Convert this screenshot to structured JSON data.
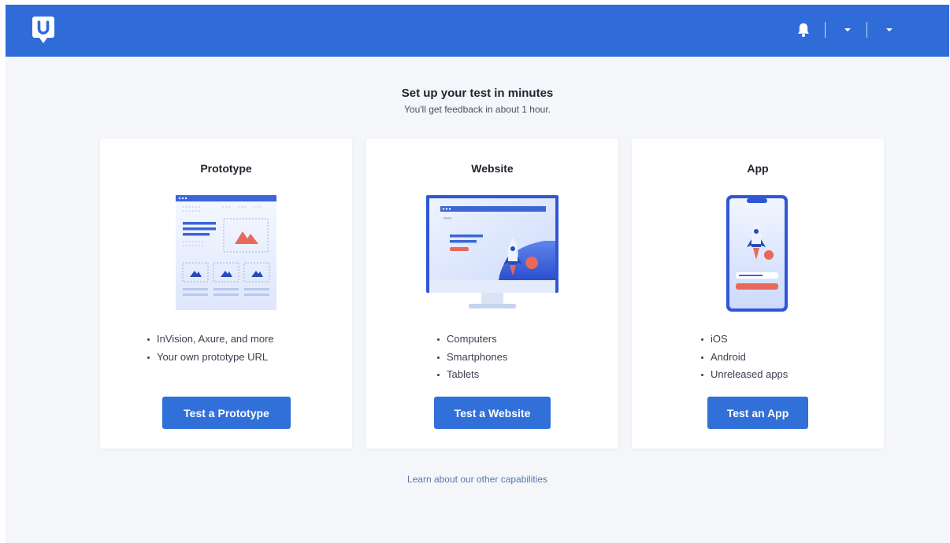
{
  "header": {
    "logo_letter": "U",
    "icons": [
      "notification-bell-icon",
      "chevron-down-icon",
      "chevron-down-icon"
    ]
  },
  "main": {
    "title": "Set up your test in minutes",
    "subtitle": "You'll get feedback in about 1 hour.",
    "cards": [
      {
        "title": "Prototype",
        "illustration": "prototype-wireframe-illustration",
        "bullets": [
          "InVision, Axure, and more",
          "Your own prototype URL"
        ],
        "button_label": "Test a Prototype"
      },
      {
        "title": "Website",
        "illustration": "desktop-monitor-rocket-illustration",
        "bullets": [
          "Computers",
          "Smartphones",
          "Tablets"
        ],
        "button_label": "Test a Website"
      },
      {
        "title": "App",
        "illustration": "smartphone-rocket-illustration",
        "bullets": [
          "iOS",
          "Android",
          "Unreleased apps"
        ],
        "button_label": "Test an App"
      }
    ],
    "footer_link": "Learn about our other capabilities"
  },
  "colors": {
    "brand_blue": "#2f6cd8",
    "button_blue": "#3170d9",
    "background": "#f4f6f9",
    "accent_coral": "#e8685a"
  }
}
